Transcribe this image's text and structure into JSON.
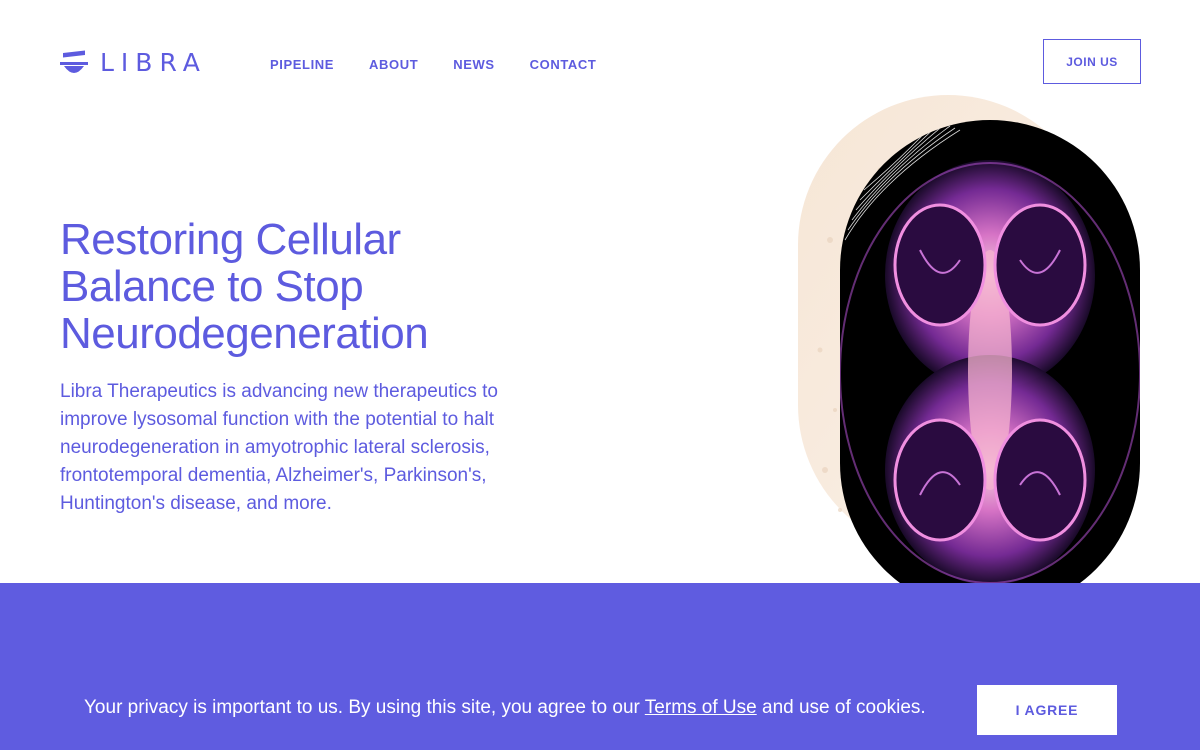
{
  "brand": {
    "name": "LIBRA",
    "logo_icon": "libra-scale-icon",
    "primary_color": "#5d5bdf",
    "band_color": "#5f5ce0"
  },
  "nav": {
    "items": [
      {
        "label": "PIPELINE"
      },
      {
        "label": "ABOUT"
      },
      {
        "label": "NEWS"
      },
      {
        "label": "CONTACT"
      }
    ],
    "join_label": "JOIN US"
  },
  "hero": {
    "title_lines": [
      "Restoring Cellular",
      "Balance to Stop",
      "Neurodegeneration"
    ],
    "description": "Libra Therapeutics is advancing new therapeutics to improve lysosomal function with the potential to halt neurodegeneration in amyotrophic lateral sclerosis, frontotemporal dementia, Alzheimer's, Parkinson's, Huntington's disease, and more."
  },
  "cookie": {
    "text_before": "Your privacy is important to us. By using this site, you agree to our ",
    "link_label": "Terms of Use",
    "text_after": " and use of cookies.",
    "agree_label": "I AGREE"
  }
}
